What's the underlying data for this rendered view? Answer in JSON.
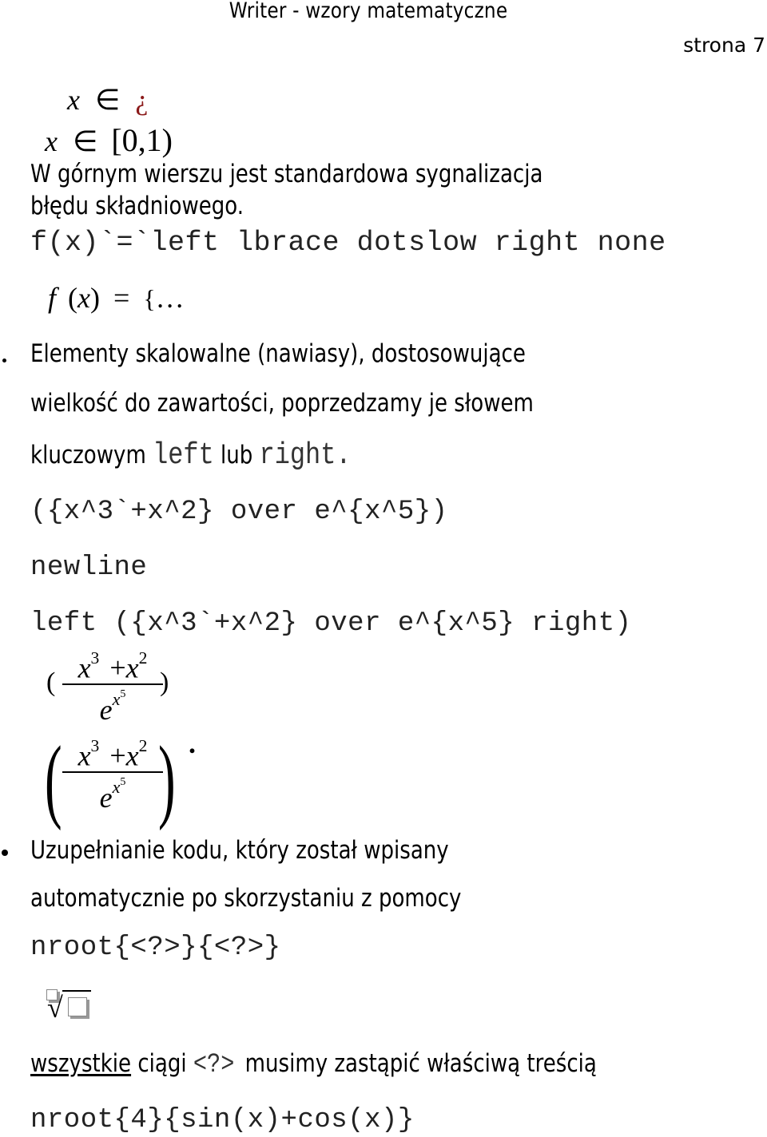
{
  "header": {
    "title": "Writer - wzory matematyczne",
    "page_label": "strona 7"
  },
  "formula_error": {
    "var": "x",
    "op": "∈",
    "error_glyph": "¿",
    "error_color": "#8b1a1a"
  },
  "formula_interval": {
    "var": "x",
    "op": "∈",
    "interval": "[0,1)"
  },
  "paragraph_syntax": {
    "line1": "W górnym wierszu jest standardowa sygnalizacja",
    "line2": "błędu składniowego."
  },
  "code_lbrace": "f(x)`=`left lbrace dotslow right none",
  "formula_lbrace": {
    "lhs_f": "f",
    "lhs_paren_open": "(",
    "lhs_x": "x",
    "lhs_paren_close": ")",
    "eq": "=",
    "brace": "{",
    "dots": "…"
  },
  "bullet_scalable": {
    "line1": "Elementy skalowalne (nawiasy), dostosowujące",
    "line2": "wielkość do zawartości, poprzedzamy je słowem",
    "line3_prefix": "kluczowym",
    "kw_left": "left",
    "mid": "lub",
    "kw_right": "right",
    "suffix": "."
  },
  "code_examples": {
    "line1": "({x^3`+x^2} over e^{x^5})",
    "line2": "newline",
    "line3": "left ({x^3`+x^2} over e^{x^5} right)"
  },
  "formula_fraction": {
    "base_x": "x",
    "exp3": "3",
    "plus": "+",
    "exp2": "2",
    "base_e": "e",
    "exp5": "5",
    "open": "(",
    "close": ")",
    "dot": "."
  },
  "bullet_autocomplete": {
    "line1": "Uzupełnianie kodu, który został wpisany",
    "line2": "automatycznie po skorzystaniu z pomocy"
  },
  "code_nroot_template": "nroot{<?>}{<?>}",
  "nroot_symbol": "√",
  "note": {
    "underlined": "wszystkie",
    "part1": "ciągi",
    "placeholder": "<?>",
    "part2": "musimy zastąpić właściwą treścią"
  },
  "code_nroot_filled": "nroot{4}{sin(x)+cos(x)}"
}
